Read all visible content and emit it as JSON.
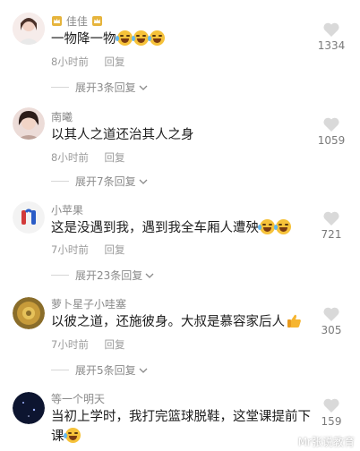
{
  "comments": [
    {
      "username": "佳佳",
      "text": "一物降一物",
      "time": "8小时前",
      "reply": "回复",
      "expand": "展开3条回复",
      "likes": "1334"
    },
    {
      "username": "南曦",
      "text": "以其人之道还治其人之身",
      "time": "8小时前",
      "reply": "回复",
      "expand": "展开7条回复",
      "likes": "1059"
    },
    {
      "username": "小苹果",
      "text": "这是没遇到我，遇到我全车厢人遭殃",
      "time": "7小时前",
      "reply": "回复",
      "expand": "展开23条回复",
      "likes": "721"
    },
    {
      "username": "萝卜星子小哇塞",
      "text": "以彼之道，还施彼身。大叔是慕容家后人",
      "time": "7小时前",
      "reply": "回复",
      "expand": "展开5条回复",
      "likes": "305"
    },
    {
      "username": "等一个明天",
      "text_line1": "当初上学时，我打完篮球脱鞋，这堂课提前下",
      "text_line2": "课",
      "likes": "159"
    }
  ],
  "watermark": "Mr张说教育",
  "icons": {
    "like": "heart-outline-icon",
    "emoji": "laughing-tears-emoji",
    "thumb": "thumbs-up-emoji",
    "chevron": "chevron-down-icon"
  },
  "colors": {
    "text": "#1c1c1c",
    "muted": "#8a8a8a",
    "emoji": "#f6c23a"
  }
}
